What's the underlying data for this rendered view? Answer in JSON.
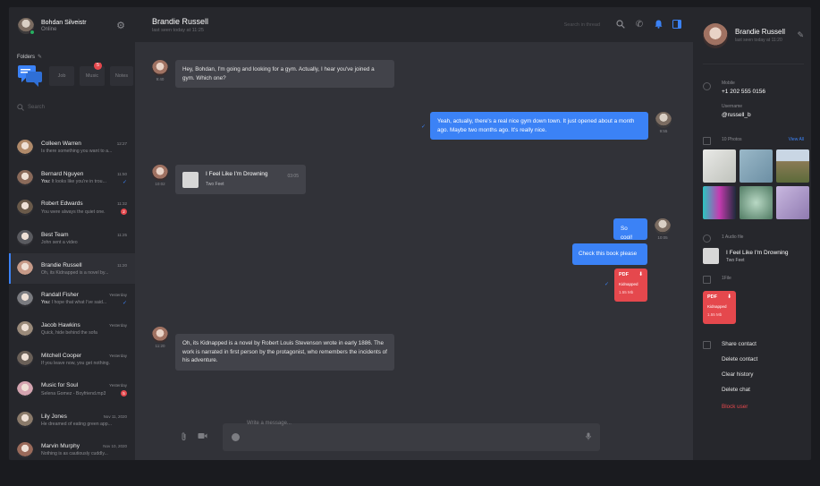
{
  "me": {
    "name": "Bohdan Silveistr",
    "status": "Online"
  },
  "folders": {
    "title": "Folders",
    "items": [
      {
        "label": "Job",
        "badge": ""
      },
      {
        "label": "Music",
        "badge": "5"
      },
      {
        "label": "Notes",
        "badge": ""
      }
    ]
  },
  "search": {
    "placeholder": "Search"
  },
  "chats": [
    {
      "name": "Colleen Warren",
      "time": "12:27",
      "preview_prefix": "",
      "preview": "Is there something you want to a...",
      "unread": "",
      "check": "",
      "avatar": "#b08a6a",
      "muted": true
    },
    {
      "name": "Bernard Nguyen",
      "time": "11:50",
      "preview_prefix": "You:",
      "preview": " It looks like you're in trou...",
      "unread": "",
      "check": "✓",
      "avatar": "#8a6a5a"
    },
    {
      "name": "Robert Edwards",
      "time": "11:32",
      "preview_prefix": "",
      "preview": "You were always the quiet one.",
      "unread": "2",
      "check": "",
      "avatar": "#6a5a4a"
    },
    {
      "name": "Best Team",
      "time": "11:25",
      "preview_prefix": "",
      "preview": "John sent a video",
      "unread": "",
      "check": "",
      "avatar": "#5a5b60",
      "group": true
    },
    {
      "name": "Brandie Russell",
      "time": "11:20",
      "preview_prefix": "",
      "preview": "Oh, its Kidnapped is a novel by...",
      "unread": "",
      "check": "",
      "avatar": "#c69a88",
      "active": true
    },
    {
      "name": "Randall Fisher",
      "time": "Yesterday",
      "preview_prefix": "You:",
      "preview": " I hope that what I've said...",
      "unread": "",
      "check": "✓",
      "avatar": "#7a7b80"
    },
    {
      "name": "Jacob Hawkins",
      "time": "Yesterday",
      "preview_prefix": "",
      "preview": "Quick, hide behind the sofa",
      "unread": "",
      "check": "",
      "avatar": "#9a8a7a"
    },
    {
      "name": "Mitchell Cooper",
      "time": "Yesterday",
      "preview_prefix": "",
      "preview": "If you leave now, you get nothing.",
      "unread": "",
      "check": "",
      "avatar": "#6a6058"
    },
    {
      "name": "Music for Soul",
      "time": "Yesterday",
      "preview_prefix": "",
      "preview": "Selena Gomez - Boyfriend.mp3",
      "unread": "5",
      "check": "",
      "avatar": "#d4a4b0",
      "channel": true
    },
    {
      "name": "Lily Jones",
      "time": "Nov 11, 2020",
      "preview_prefix": "",
      "preview": "He dreamed of eating green app...",
      "unread": "",
      "check": "",
      "avatar": "#8a7a6a"
    },
    {
      "name": "Marvin Murphy",
      "time": "Nov 10, 2020",
      "preview_prefix": "",
      "preview": "Nothing is as cautiously cuddly...",
      "unread": "",
      "check": "",
      "avatar": "#9a6a5a"
    }
  ],
  "header": {
    "name": "Brandie Russell",
    "seen": "last seen today at 11:25",
    "search_placeholder": "Search in thread"
  },
  "messages": {
    "m1": {
      "time": "9:40",
      "text": "Hey, Bohdan, I'm going and looking for a gym. Actually, I hear you've joined a gym. Which one?"
    },
    "m2": {
      "time": "9:55",
      "text": "Yeah, actually, there's a real nice gym down town. It just opened about a month ago. Maybe two months ago. It's really nice."
    },
    "m3": {
      "time": "10:02",
      "title": "I Feel Like I'm Drowning",
      "artist": "Two Feet",
      "duration": "03:05"
    },
    "m4": {
      "time": "10:05",
      "text1": "So cool!",
      "text2": "Check this book please",
      "pdf_label": "PDF",
      "pdf_name": "Kidnapped",
      "pdf_size": "1.55 Mb"
    },
    "m5": {
      "time": "11:20",
      "text": "Oh, its Kidnapped is a novel by Robert Louis Stevenson wrote in early 1886. The work is narrated in first person by the protagonist, who remembers the incidents of his adventure."
    }
  },
  "composer": {
    "placeholder": "Write a message..."
  },
  "profile": {
    "name": "Brandie Russell",
    "seen": "last seen today at 11:20",
    "mobile_label": "Mobile",
    "mobile": "+1 202 555 0156",
    "username_label": "Username",
    "username": "@russell_b",
    "photos_label": "10 Photos",
    "view_all": "View All",
    "audio_label": "1 Audio file",
    "audio_title": "I Feel Like I'm Drowning",
    "audio_artist": "Two Feet",
    "file_label": "1File",
    "pdf_label": "PDF",
    "pdf_name": "Kidnapped",
    "pdf_size": "1.55 Mb",
    "actions": [
      "Share contact",
      "Delete contact",
      "Clear history",
      "Delete chat"
    ],
    "danger_action": "Block user"
  },
  "colors": {
    "accent": "#3b82f6",
    "danger": "#e5484d",
    "online": "#27ae60"
  }
}
